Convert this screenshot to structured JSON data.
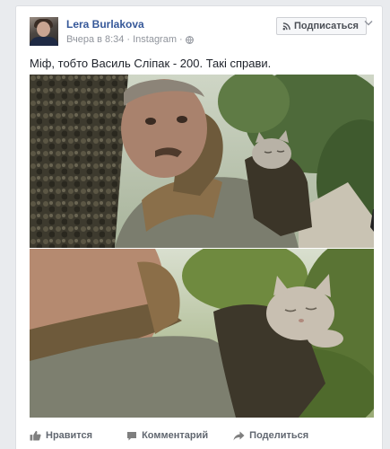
{
  "post": {
    "author": "Lera Burlakova",
    "time": "Вчера в 8:34",
    "separator": "·",
    "source": "Instagram",
    "subscribe_label": "Подписаться",
    "text": "Міф, тобто Василь Сліпак - 200. Такі справи."
  },
  "actions": {
    "like": "Нравится",
    "comment": "Комментарий",
    "share": "Поделиться"
  },
  "icons": {
    "audience": "globe-icon",
    "subscribe": "rss-icon",
    "menu": "chevron-down-icon",
    "like": "thumbs-up-icon",
    "comment": "comment-icon",
    "share": "share-arrow-icon"
  },
  "colors": {
    "link": "#365899",
    "meta": "#90949c",
    "action": "#616770"
  }
}
